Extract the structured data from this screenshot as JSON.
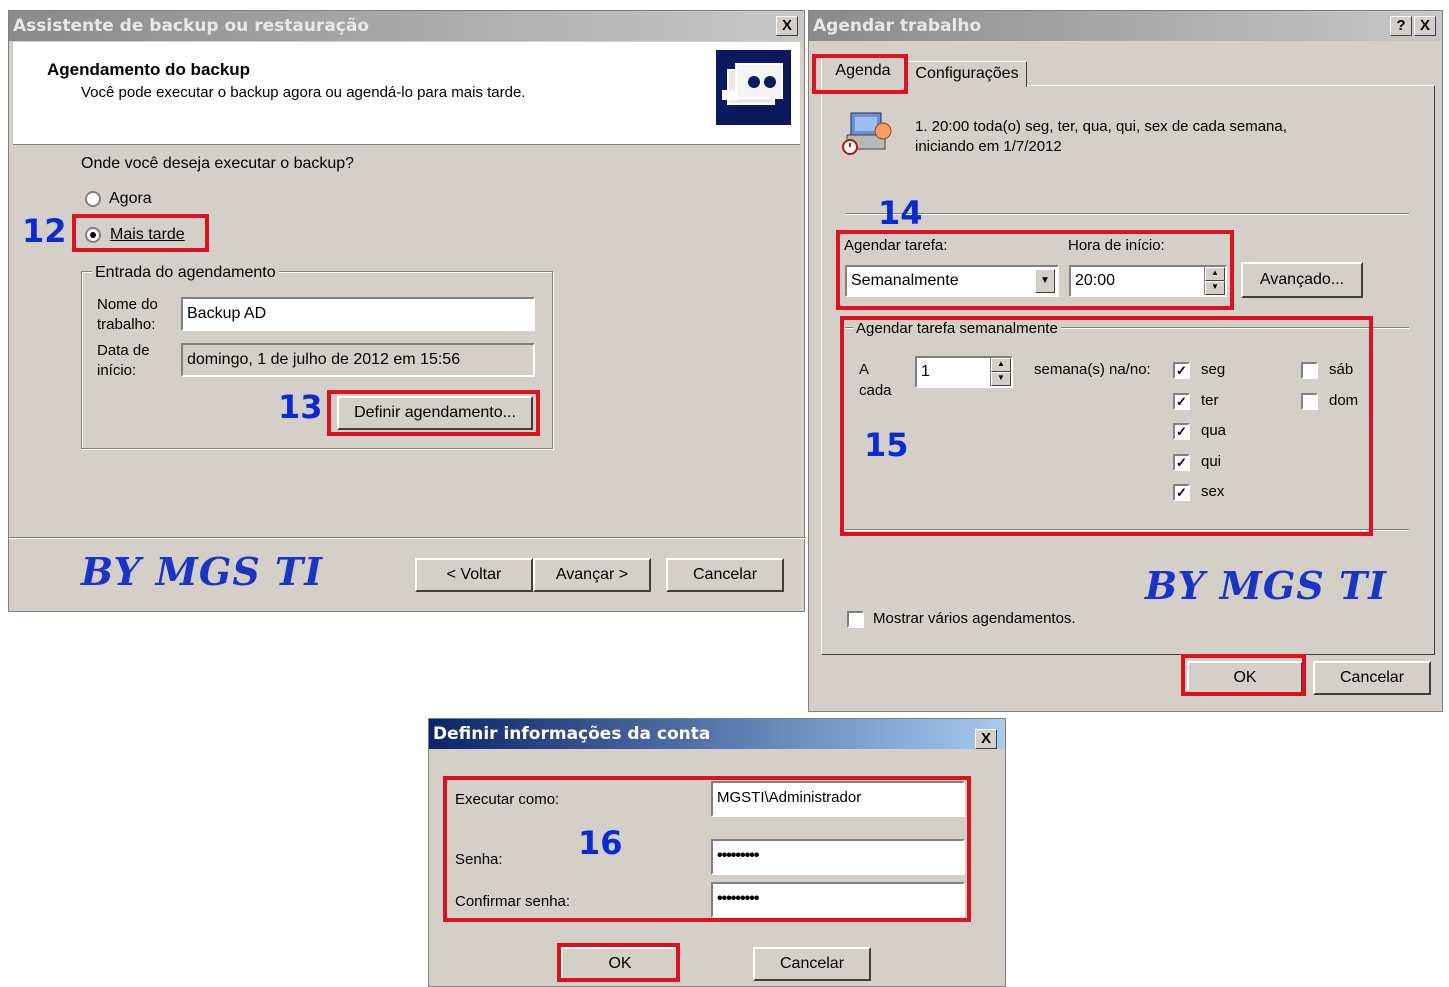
{
  "backup_wizard": {
    "title": "Assistente de backup ou restauração",
    "header_title": "Agendamento do backup",
    "header_subtitle": "Você pode executar o backup agora ou agendá-lo para mais tarde.",
    "question": "Onde você deseja executar o backup?",
    "option_now": "Agora",
    "option_later": "Mais tarde",
    "group_title": "Entrada do agendamento",
    "job_name_label_1": "Nome do",
    "job_name_label_2": "trabalho:",
    "job_name_value": "Backup AD",
    "start_date_label_1": "Data de",
    "start_date_label_2": "início:",
    "start_date_value": "domingo, 1 de julho de 2012 em 15:56",
    "define_schedule_button": "Definir agendamento...",
    "back_button": "< Voltar",
    "next_button": "Avançar >",
    "cancel_button": "Cancelar",
    "close_glyph": "X"
  },
  "schedule_job": {
    "title": "Agendar trabalho",
    "help_glyph": "?",
    "close_glyph": "X",
    "tabs": [
      "Agenda",
      "Configurações"
    ],
    "summary_line_1": "1. 20:00 toda(o) seg, ter, qua, qui, sex de cada semana,",
    "summary_line_2": "iniciando em 1/7/2012",
    "schedule_task_label": "Agendar tarefa:",
    "schedule_task_value": "Semanalmente",
    "start_time_label": "Hora de início:",
    "start_time_value": "20:00",
    "advanced_button": "Avançado...",
    "weekly_group_title": "Agendar tarefa semanalmente",
    "every_label_1": "A",
    "every_label_2": "cada",
    "every_value": "1",
    "weeks_on_label": "semana(s) na/no:",
    "days": [
      {
        "label": "seg",
        "checked": true
      },
      {
        "label": "ter",
        "checked": true
      },
      {
        "label": "qua",
        "checked": true
      },
      {
        "label": "qui",
        "checked": true
      },
      {
        "label": "sex",
        "checked": true
      },
      {
        "label": "sáb",
        "checked": false
      },
      {
        "label": "dom",
        "checked": false
      }
    ],
    "check_glyph": "✓",
    "show_multiple_label": "Mostrar vários agendamentos.",
    "ok_button": "OK",
    "cancel_button": "Cancelar"
  },
  "account_info": {
    "title": "Definir informações da conta",
    "close_glyph": "X",
    "run_as_label": "Executar como:",
    "run_as_value": "MGSTI\\Administrador",
    "password_label": "Senha:",
    "password_value": "•••••••••",
    "confirm_label": "Confirmar senha:",
    "confirm_value": "•••••••••",
    "ok_button": "OK",
    "cancel_button": "Cancelar"
  },
  "annotations": {
    "step_12": "12",
    "step_13": "13",
    "step_14": "14",
    "step_15": "15",
    "step_16": "16",
    "watermark": "BY MGS TI",
    "highlight_color": "#e01020",
    "number_color": "#0a2ad8"
  }
}
